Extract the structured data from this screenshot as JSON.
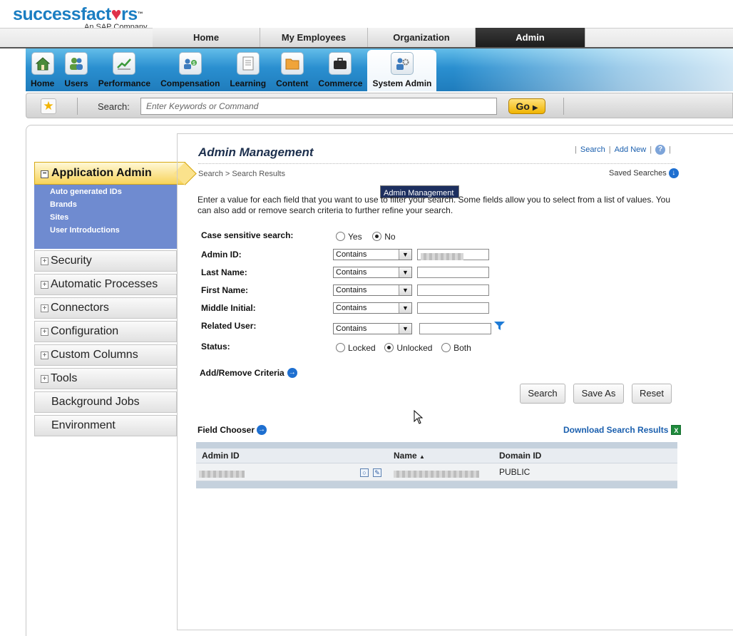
{
  "logo": {
    "brand_a": "success",
    "brand_b": "fact",
    "brand_heart": "♥",
    "brand_c": "rs",
    "tm": "™",
    "sub": "An SAP Company"
  },
  "topnav": [
    "Home",
    "My Employees",
    "Organization",
    "Admin"
  ],
  "modules": [
    {
      "label": "Home",
      "icon": "home-icon"
    },
    {
      "label": "Users",
      "icon": "users-icon"
    },
    {
      "label": "Performance",
      "icon": "performance-icon"
    },
    {
      "label": "Compensation",
      "icon": "compensation-icon"
    },
    {
      "label": "Learning",
      "icon": "learning-icon"
    },
    {
      "label": "Content",
      "icon": "content-icon"
    },
    {
      "label": "Commerce",
      "icon": "commerce-icon"
    },
    {
      "label": "System Admin",
      "icon": "system-admin-icon"
    }
  ],
  "search": {
    "label": "Search:",
    "placeholder": "Enter Keywords or Command",
    "go": "Go"
  },
  "sidebar": {
    "app_admin": "Application Admin",
    "sub_items": [
      "Admin Management",
      "Auto generated IDs",
      "Brands",
      "Sites",
      "User Introductions"
    ],
    "sections": [
      "Security",
      "Automatic Processes",
      "Connectors",
      "Configuration",
      "Custom Columns",
      "Tools",
      "Background Jobs",
      "Environment"
    ]
  },
  "main": {
    "title": "Admin Management",
    "link_search": "Search",
    "link_addnew": "Add New",
    "help": "?",
    "breadcrumb": "Search > Search Results",
    "saved_searches": "Saved Searches",
    "intro": "Enter a value for each field that you want to use to filter your search. Some fields allow you to select from a list of values. You can also add or remove search criteria to further refine your search."
  },
  "form": {
    "case_label": "Case sensitive search:",
    "case_yes": "Yes",
    "case_no": "No",
    "admin_id": "Admin ID:",
    "last_name": "Last Name:",
    "first_name": "First Name:",
    "middle_initial": "Middle Initial:",
    "related_user": "Related User:",
    "status": "Status:",
    "status_locked": "Locked",
    "status_unlocked": "Unlocked",
    "status_both": "Both",
    "operator": "Contains",
    "add_remove": "Add/Remove Criteria",
    "btn_search": "Search",
    "btn_saveas": "Save As",
    "btn_reset": "Reset"
  },
  "results": {
    "field_chooser": "Field Chooser",
    "download": "Download Search Results",
    "columns": [
      "Admin ID",
      "Name",
      "Domain ID"
    ],
    "sort_indicator": "▲",
    "rows": [
      {
        "domain": "PUBLIC"
      }
    ]
  }
}
